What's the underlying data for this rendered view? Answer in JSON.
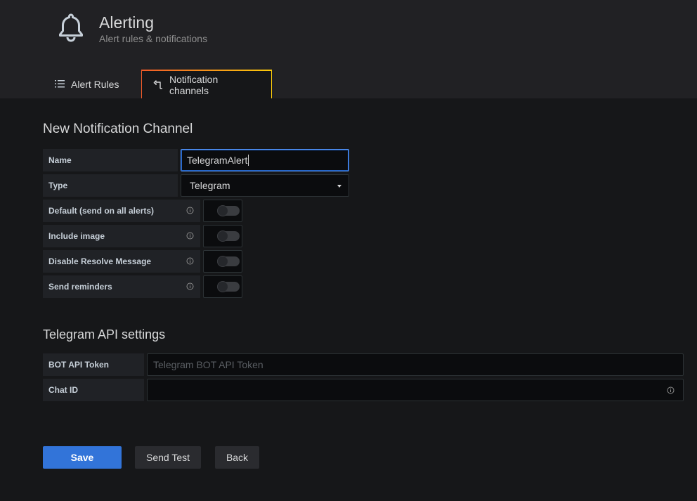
{
  "header": {
    "title": "Alerting",
    "subtitle": "Alert rules & notifications",
    "icon": "bell-icon"
  },
  "tabs": [
    {
      "label": "Alert Rules",
      "icon": "list-icon",
      "active": false
    },
    {
      "label": "Notification channels",
      "icon": "notification-icon",
      "active": true
    }
  ],
  "form": {
    "title": "New Notification Channel",
    "name": {
      "label": "Name",
      "value": "TelegramAlert"
    },
    "type": {
      "label": "Type",
      "value": "Telegram"
    },
    "toggles": [
      {
        "label": "Default (send on all alerts)",
        "on": false
      },
      {
        "label": "Include image",
        "on": false
      },
      {
        "label": "Disable Resolve Message",
        "on": false
      },
      {
        "label": "Send reminders",
        "on": false
      }
    ]
  },
  "telegram": {
    "title": "Telegram API settings",
    "bot_token": {
      "label": "BOT API Token",
      "value": "",
      "placeholder": "Telegram BOT API Token"
    },
    "chat_id": {
      "label": "Chat ID",
      "value": ""
    }
  },
  "buttons": {
    "save": "Save",
    "send_test": "Send Test",
    "back": "Back"
  },
  "colors": {
    "accent": "#3274d9",
    "tab_gradient_start": "#f05a28",
    "tab_gradient_end": "#fbca0a",
    "focus": "#5794f2"
  }
}
